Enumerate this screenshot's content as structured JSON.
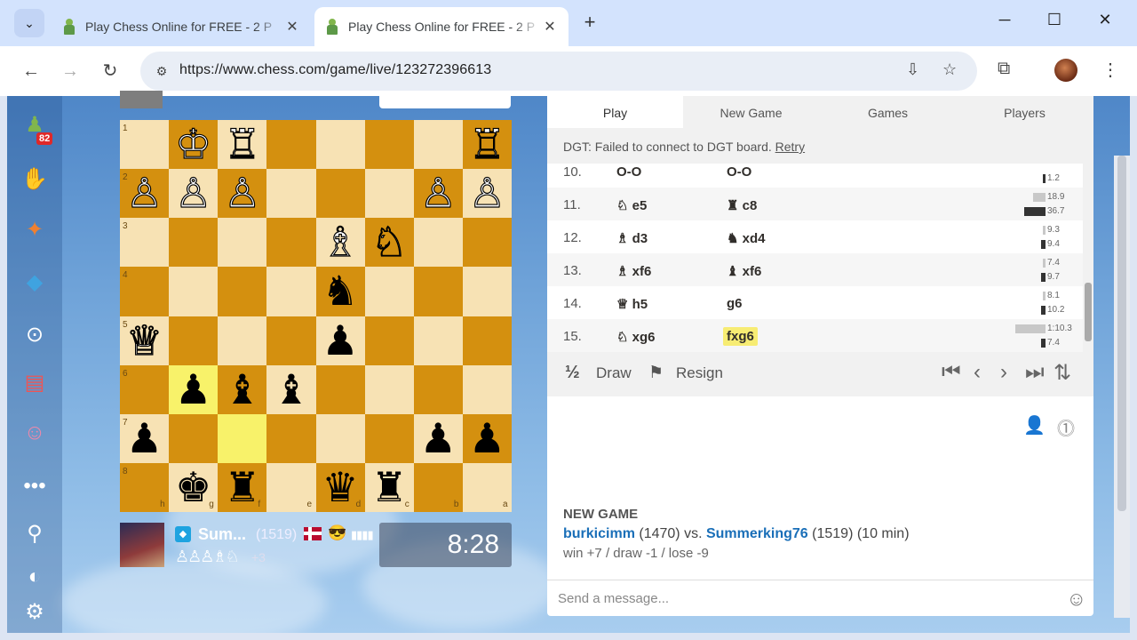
{
  "browser": {
    "tabs": [
      {
        "title": "Play Chess Online for FREE - 2 P"
      },
      {
        "title": "Play Chess Online for FREE - 2 P"
      }
    ],
    "url": "https://www.chess.com/game/live/123272396613"
  },
  "sidebar": {
    "notification_count": "82"
  },
  "board": {
    "ranks": [
      "1",
      "2",
      "3",
      "4",
      "5",
      "6",
      "7",
      "8"
    ],
    "files": [
      "h",
      "g",
      "f",
      "e",
      "d",
      "c",
      "b",
      "a"
    ],
    "highlighted": [
      "f7",
      "g6"
    ],
    "pieces": [
      {
        "sq": "g1",
        "p": "♔",
        "c": "w"
      },
      {
        "sq": "f1",
        "p": "♖",
        "c": "w"
      },
      {
        "sq": "a1",
        "p": "♖",
        "c": "w"
      },
      {
        "sq": "h2",
        "p": "♙",
        "c": "w"
      },
      {
        "sq": "g2",
        "p": "♙",
        "c": "w"
      },
      {
        "sq": "f2",
        "p": "♙",
        "c": "w"
      },
      {
        "sq": "b2",
        "p": "♙",
        "c": "w"
      },
      {
        "sq": "a2",
        "p": "♙",
        "c": "w"
      },
      {
        "sq": "d3",
        "p": "♗",
        "c": "w"
      },
      {
        "sq": "c3",
        "p": "♘",
        "c": "w"
      },
      {
        "sq": "d4",
        "p": "♞",
        "c": "b"
      },
      {
        "sq": "h5",
        "p": "♕",
        "c": "w"
      },
      {
        "sq": "d5",
        "p": "♟",
        "c": "b"
      },
      {
        "sq": "g6",
        "p": "♟",
        "c": "b"
      },
      {
        "sq": "f6",
        "p": "♝",
        "c": "b"
      },
      {
        "sq": "e6",
        "p": "♝",
        "c": "b"
      },
      {
        "sq": "h7",
        "p": "♟",
        "c": "b"
      },
      {
        "sq": "b7",
        "p": "♟",
        "c": "b"
      },
      {
        "sq": "a7",
        "p": "♟",
        "c": "b"
      },
      {
        "sq": "g8",
        "p": "♚",
        "c": "b"
      },
      {
        "sq": "f8",
        "p": "♜",
        "c": "b"
      },
      {
        "sq": "d8",
        "p": "♛",
        "c": "b"
      },
      {
        "sq": "c8",
        "p": "♜",
        "c": "b"
      }
    ]
  },
  "player_bottom": {
    "name": "Sum...",
    "rating": "(1519)",
    "captured": "♙♙♙♗♘",
    "advantage": "+3",
    "clock": "8:28"
  },
  "panel": {
    "tabs": [
      "Play",
      "New Game",
      "Games",
      "Players"
    ],
    "dgt_message": "DGT: Failed to connect to DGT board.",
    "dgt_retry": "Retry",
    "moves": [
      {
        "n": "10.",
        "w": "O-O",
        "b": "O-O",
        "wt": "",
        "bt": "1.2"
      },
      {
        "n": "11.",
        "w": "♘ e5",
        "b": "♜ c8",
        "wt": "18.9",
        "bt": "36.7"
      },
      {
        "n": "12.",
        "w": "♗ d3",
        "b": "♞ xd4",
        "wt": "9.3",
        "bt": "9.4"
      },
      {
        "n": "13.",
        "w": "♗ xf6",
        "b": "♝ xf6",
        "wt": "7.4",
        "bt": "9.7"
      },
      {
        "n": "14.",
        "w": "♕ h5",
        "b": "g6",
        "wt": "8.1",
        "bt": "10.2"
      },
      {
        "n": "15.",
        "w": "♘ xg6",
        "b": "fxg6",
        "wt": "1:10.3",
        "bt": "7.4"
      }
    ],
    "draw_label": "Draw",
    "resign_label": "Resign",
    "draw_icon": "½",
    "new_game_heading": "NEW GAME",
    "player1": "burkicimm",
    "player1_rating": "(1470) vs.",
    "player2": "Summerking76",
    "player2_rating": "(1519) (10 min)",
    "wdl": "win +7 / draw -1 / lose -9",
    "message_placeholder": "Send a message..."
  }
}
